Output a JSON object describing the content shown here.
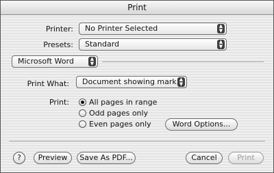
{
  "window": {
    "title": "Print"
  },
  "printer": {
    "label": "Printer:",
    "value": "No Printer Selected"
  },
  "presets": {
    "label": "Presets:",
    "value": "Standard"
  },
  "section_popup": {
    "value": "Microsoft Word"
  },
  "print_what": {
    "label": "Print What:",
    "value": "Document showing mark..."
  },
  "print": {
    "label": "Print:",
    "options": [
      {
        "label": "All pages in range",
        "selected": true
      },
      {
        "label": "Odd pages only",
        "selected": false
      },
      {
        "label": "Even pages only",
        "selected": false
      }
    ]
  },
  "buttons": {
    "word_options": "Word Options...",
    "help": "?",
    "preview": "Preview",
    "save_as_pdf": "Save As PDF...",
    "cancel": "Cancel",
    "print": "Print"
  }
}
